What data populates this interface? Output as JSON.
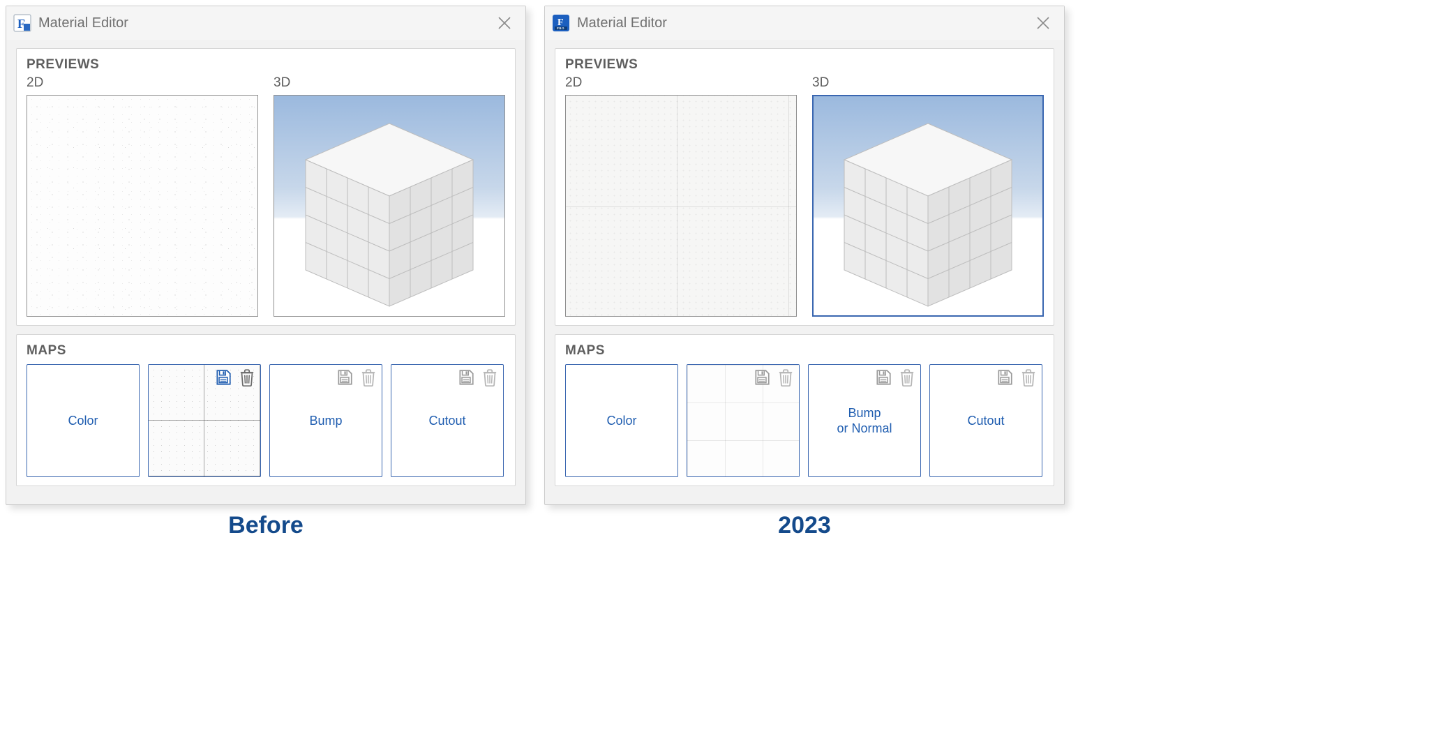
{
  "windows": [
    {
      "key": "before",
      "title": "Material Editor",
      "app_icon_variant": "classic",
      "previews_heading": "PREVIEWS",
      "label_2d": "2D",
      "label_3d": "3D",
      "preview_2d_style": "speckle",
      "preview_3d_selected": false,
      "maps_heading": "MAPS",
      "maps": [
        {
          "label": "Color",
          "has_thumb": false,
          "save_enabled": false,
          "delete_enabled": false,
          "show_icons": false
        },
        {
          "label": "",
          "has_thumb": true,
          "thumb_style": "dark",
          "save_enabled": true,
          "delete_enabled": true,
          "show_icons": true
        },
        {
          "label": "Bump",
          "has_thumb": false,
          "save_enabled": false,
          "delete_enabled": false,
          "show_icons": true
        },
        {
          "label": "Cutout",
          "has_thumb": false,
          "save_enabled": false,
          "delete_enabled": false,
          "show_icons": true
        }
      ],
      "caption": "Before"
    },
    {
      "key": "after",
      "title": "Material Editor",
      "app_icon_variant": "pro",
      "previews_heading": "PREVIEWS",
      "label_2d": "2D",
      "label_3d": "3D",
      "preview_2d_style": "tile",
      "preview_3d_selected": true,
      "maps_heading": "MAPS",
      "maps": [
        {
          "label": "Color",
          "has_thumb": false,
          "save_enabled": false,
          "delete_enabled": false,
          "show_icons": false
        },
        {
          "label": "",
          "has_thumb": true,
          "thumb_style": "light",
          "save_enabled": false,
          "delete_enabled": false,
          "show_icons": true
        },
        {
          "label": "Bump\nor Normal",
          "has_thumb": false,
          "save_enabled": false,
          "delete_enabled": false,
          "show_icons": true
        },
        {
          "label": "Cutout",
          "has_thumb": false,
          "save_enabled": false,
          "delete_enabled": false,
          "show_icons": true
        }
      ],
      "caption": "2023"
    }
  ],
  "icons": {
    "save": "save-icon",
    "delete": "trash-icon",
    "close": "close-icon"
  }
}
